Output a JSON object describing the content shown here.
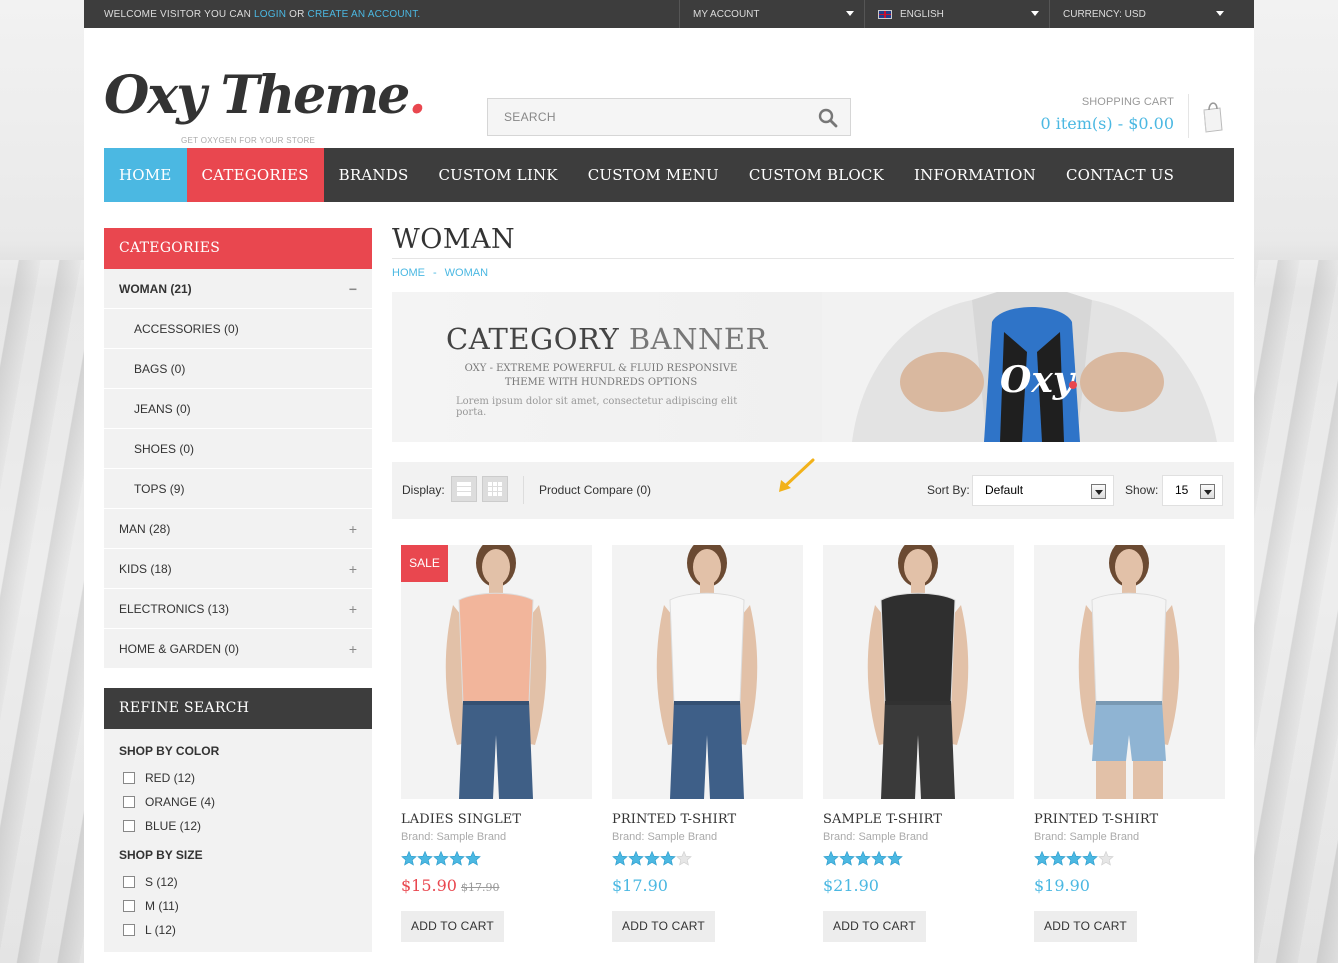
{
  "topbar": {
    "welcome_prefix": "WELCOME VISITOR YOU CAN",
    "login": "LOGIN",
    "or": "OR",
    "create_account": "CREATE AN ACCOUNT.",
    "my_account": "MY ACCOUNT",
    "language": "ENGLISH",
    "currency": "CURRENCY: USD"
  },
  "header": {
    "logo": "Oxy Theme",
    "logo_dot": ".",
    "tagline": "GET OXYGEN FOR YOUR STORE",
    "search_placeholder": "SEARCH",
    "cart_title": "SHOPPING CART",
    "cart_total": "0 item(s) - $0.00"
  },
  "nav": {
    "items": [
      "HOME",
      "CATEGORIES",
      "BRANDS",
      "CUSTOM LINK",
      "CUSTOM MENU",
      "CUSTOM BLOCK",
      "INFORMATION",
      "CONTACT US"
    ]
  },
  "sidebar": {
    "categories_title": "CATEGORIES",
    "categories": [
      {
        "label": "WOMAN (21)",
        "toggle": "−"
      },
      {
        "label": "ACCESSORIES (0)"
      },
      {
        "label": "BAGS (0)"
      },
      {
        "label": "JEANS (0)"
      },
      {
        "label": "SHOES (0)"
      },
      {
        "label": "TOPS (9)"
      },
      {
        "label": "MAN (28)",
        "toggle": "+"
      },
      {
        "label": "KIDS (18)",
        "toggle": "+"
      },
      {
        "label": "ELECTRONICS (13)",
        "toggle": "+"
      },
      {
        "label": "HOME & GARDEN (0)",
        "toggle": "+"
      }
    ],
    "refine_title": "REFINE SEARCH",
    "color_title": "SHOP BY COLOR",
    "colors": [
      "RED (12)",
      "ORANGE (4)",
      "BLUE (12)"
    ],
    "size_title": "SHOP BY SIZE",
    "sizes": [
      "S (12)",
      "M (11)",
      "L (12)"
    ]
  },
  "main": {
    "title": "WOMAN",
    "breadcrumb": [
      "HOME",
      "WOMAN"
    ],
    "breadcrumb_sep": "-",
    "banner": {
      "title_bold": "CATEGORY",
      "title_thin": "BANNER",
      "subtitle": "OXY - EXTREME POWERFUL & FLUID RESPONSIVE THEME WITH HUNDREDS OPTIONS",
      "lorem": "Lorem ipsum dolor sit amet, consectetur adipiscing elit porta.",
      "shirt_logo": "Oxy"
    },
    "toolbar": {
      "display_label": "Display:",
      "compare": "Product Compare (0)",
      "sort_label": "Sort By:",
      "sort_value": "Default",
      "show_label": "Show:",
      "show_value": "15"
    }
  },
  "products": [
    {
      "name": "LADIES SINGLET",
      "brand": "Brand: Sample Brand",
      "rating": 5,
      "price": "$15.90",
      "old_price": "$17.90",
      "badge": "SALE",
      "button": "ADD TO CART",
      "shirt_color": "#f2b59b",
      "pants_color": "#3f5f86"
    },
    {
      "name": "PRINTED T-SHIRT",
      "brand": "Brand: Sample Brand",
      "rating": 4,
      "price": "$17.90",
      "button": "ADD TO CART",
      "shirt_color": "#f7f7f7",
      "pants_color": "#3e5f88"
    },
    {
      "name": "SAMPLE T-SHIRT",
      "brand": "Brand: Sample Brand",
      "rating": 5,
      "price": "$21.90",
      "button": "ADD TO CART",
      "shirt_color": "#2f2f2f",
      "pants_color": "#3a3a3a"
    },
    {
      "name": "PRINTED T-SHIRT",
      "brand": "Brand: Sample Brand",
      "rating": 4,
      "price": "$19.90",
      "button": "ADD TO CART",
      "shirt_color": "#f4f4f4",
      "pants_color": "#8fb4d3"
    }
  ],
  "colors": {
    "accent_blue": "#4bb8e2",
    "accent_red": "#e9474f",
    "dark": "#3d3d3d",
    "star": "#4bb8e2"
  }
}
